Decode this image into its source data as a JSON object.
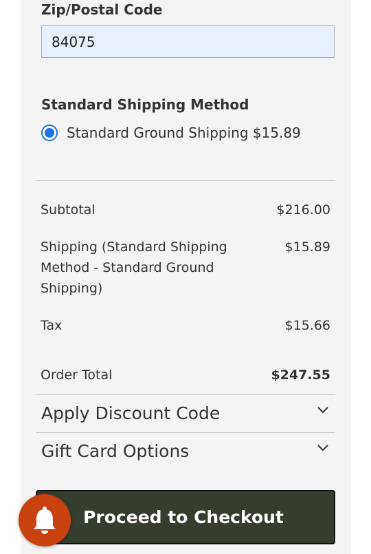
{
  "shipping_form": {
    "zip_label": "Zip/Postal Code",
    "zip_value": "84075"
  },
  "shipping_method": {
    "heading": "Standard Shipping Method",
    "option_label": "Standard Ground Shipping $15.89",
    "selected": true
  },
  "summary": {
    "subtotal_label": "Subtotal",
    "subtotal_value": "$216.00",
    "shipping_label_line1": "Shipping (Standard Shipping",
    "shipping_label_line2": "Method - Standard Ground",
    "shipping_label_line3": "Shipping)",
    "shipping_value": "$15.89",
    "tax_label": "Tax",
    "tax_value": "$15.66",
    "total_label": "Order Total",
    "total_value": "$247.55"
  },
  "accordions": {
    "discount_label": "Apply Discount Code",
    "giftcard_label": "Gift Card Options"
  },
  "checkout": {
    "button_label": "Proceed to Checkout"
  },
  "icons": {
    "notification": "bell-icon",
    "expand": "chevron-down-icon"
  },
  "colors": {
    "checkout_bg": "#353d2e",
    "bell_bg": "#c8410f",
    "radio_accent": "#1a73e8",
    "input_bg": "#e8f0fe"
  }
}
